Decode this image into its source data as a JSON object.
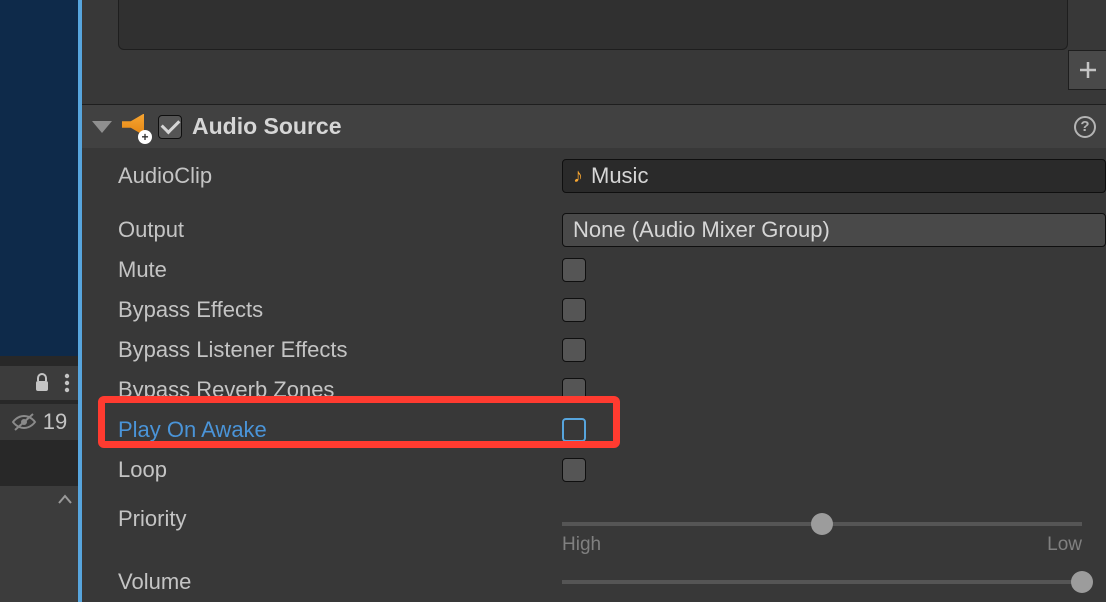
{
  "left": {
    "count": "19"
  },
  "component": {
    "title": "Audio Source",
    "enabled": true
  },
  "props": {
    "audioClip": {
      "label": "AudioClip",
      "value": "Music"
    },
    "output": {
      "label": "Output",
      "value": "None (Audio Mixer Group)"
    },
    "mute": {
      "label": "Mute",
      "checked": false
    },
    "bypassEffects": {
      "label": "Bypass Effects",
      "checked": false
    },
    "bypassListenerEffects": {
      "label": "Bypass Listener Effects",
      "checked": false
    },
    "bypassReverbZones": {
      "label": "Bypass Reverb Zones",
      "checked": false
    },
    "playOnAwake": {
      "label": "Play On Awake",
      "checked": false
    },
    "loop": {
      "label": "Loop",
      "checked": false
    },
    "priority": {
      "label": "Priority",
      "leftLabel": "High",
      "rightLabel": "Low"
    },
    "volume": {
      "label": "Volume"
    }
  },
  "highlightColor": "#ff3b30"
}
